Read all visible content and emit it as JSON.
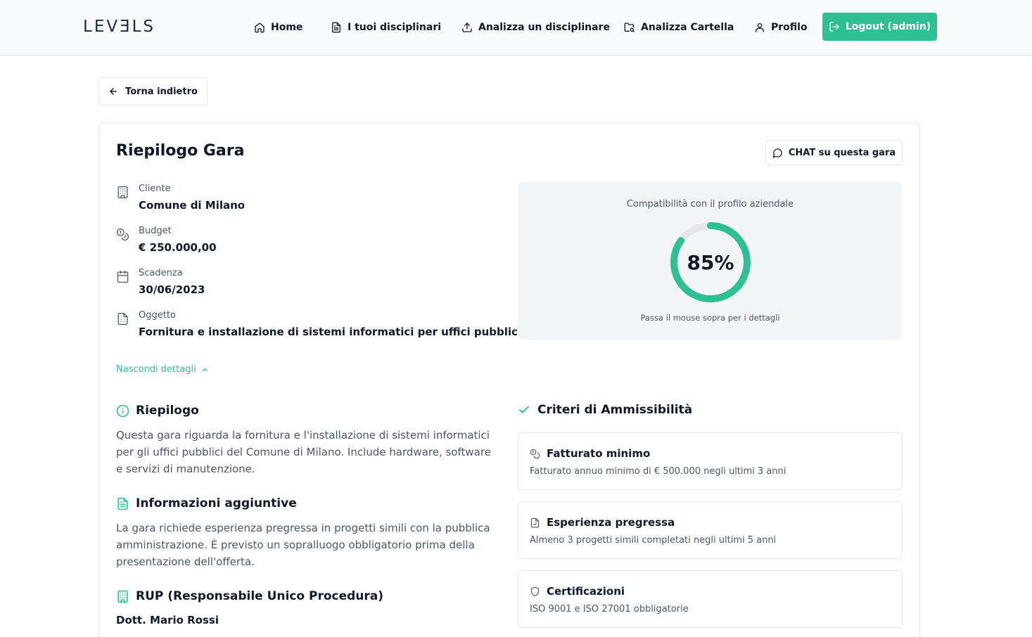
{
  "nav": {
    "logo": "LEVƎLS",
    "items": [
      {
        "label": "Home",
        "icon": "home-icon"
      },
      {
        "label": "I tuoi disciplinari",
        "icon": "document-icon"
      },
      {
        "label": "Analizza un disciplinare",
        "icon": "upload-icon"
      },
      {
        "label": "Analizza Cartella",
        "icon": "folder-search-icon"
      },
      {
        "label": "Profilo",
        "icon": "user-icon"
      }
    ],
    "logout_label": "Logout (admin)"
  },
  "back_label": "Torna indietro",
  "summary": {
    "title": "Riepilogo Gara",
    "chat_label": "CHAT su questa gara",
    "fields": [
      {
        "label": "Cliente",
        "value": "Comune di Milano",
        "icon": "building-icon"
      },
      {
        "label": "Budget",
        "value": "€ 250.000,00",
        "icon": "coins-icon"
      },
      {
        "label": "Scadenza",
        "value": "30/06/2023",
        "icon": "calendar-icon"
      },
      {
        "label": "Oggetto",
        "value": "Fornitura e installazione di sistemi informatici per uffici pubblici",
        "icon": "file-icon"
      }
    ],
    "toggle_label": "Nascondi dettagli"
  },
  "compatibility": {
    "title": "Compatibilità con il profilo aziendale",
    "percent": 85,
    "percent_label": "85%",
    "hint": "Passa il mouse sopra per i dettagli",
    "color": "#2fbf95",
    "track_color": "#e5e7eb"
  },
  "sections": {
    "riepilogo": {
      "title": "Riepilogo",
      "body": "Questa gara riguarda la fornitura e l'installazione di sistemi informatici per gli uffici pubblici del Comune di Milano. Include hardware, software e servizi di manutenzione."
    },
    "info": {
      "title": "Informazioni aggiuntive",
      "body": "La gara richiede esperienza pregressa in progetti simili con la pubblica amministrazione. È previsto un sopralluogo obbligatorio prima della presentazione dell'offerta."
    },
    "rup": {
      "title": "RUP (Responsabile Unico Procedura)",
      "name": "Dott. Mario Rossi"
    }
  },
  "criteria": {
    "title": "Criteri di Ammissibilità",
    "items": [
      {
        "title": "Fatturato minimo",
        "desc": "Fatturato annuo minimo di € 500.000 negli ultimi 3 anni",
        "icon": "coins-icon"
      },
      {
        "title": "Esperienza pregressa",
        "desc": "Almeno 3 progetti simili completati negli ultimi 5 anni",
        "icon": "file-check-icon"
      },
      {
        "title": "Certificazioni",
        "desc": "ISO 9001 e ISO 27001 obbligatorie",
        "icon": "shield-icon"
      }
    ]
  },
  "colors": {
    "accent": "#2fbf95",
    "text": "#111827",
    "muted": "#4b5563"
  }
}
